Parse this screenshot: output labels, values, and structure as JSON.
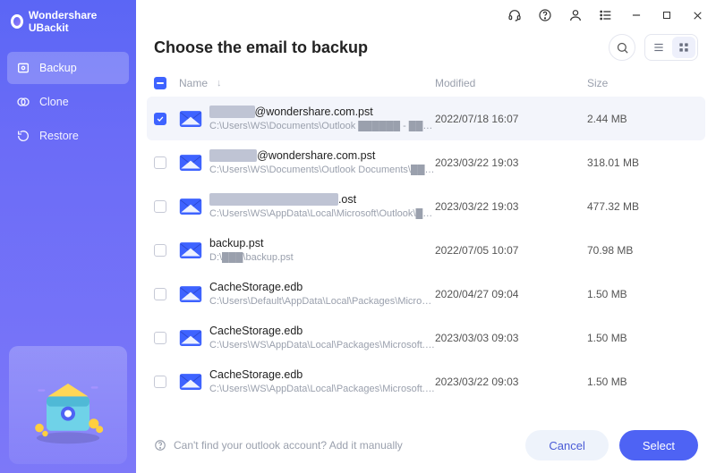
{
  "app": {
    "title": "Wondershare UBackit"
  },
  "sidebar": {
    "items": [
      {
        "label": "Backup"
      },
      {
        "label": "Clone"
      },
      {
        "label": "Restore"
      }
    ]
  },
  "header": {
    "title": "Choose the email to backup"
  },
  "columns": {
    "name": "Name",
    "modified": "Modified",
    "size": "Size"
  },
  "emails": [
    {
      "checked": true,
      "title_prefix_obf": "s█████",
      "title_suffix": "@wondershare.com.pst",
      "path": "C:\\Users\\WS\\Documents\\Outlook ██████ - ███████@wo...",
      "modified": "2022/07/18 16:07",
      "size": "2.44 MB"
    },
    {
      "checked": false,
      "title_prefix_obf": "██████",
      "title_suffix": "@wondershare.com.pst",
      "path": "C:\\Users\\WS\\Documents\\Outlook Documents\\███████ f...",
      "modified": "2023/03/22 19:03",
      "size": "318.01 MB"
    },
    {
      "checked": false,
      "title_prefix_obf": "█████████ - ██████",
      "title_suffix": ".ost",
      "path": "C:\\Users\\WS\\AppData\\Local\\Microsoft\\Outlook\\██████...",
      "modified": "2023/03/22 19:03",
      "size": "477.32 MB"
    },
    {
      "checked": false,
      "title_prefix_obf": "",
      "title_suffix": "backup.pst",
      "path": "D:\\███\\backup.pst",
      "modified": "2022/07/05 10:07",
      "size": "70.98 MB"
    },
    {
      "checked": false,
      "title_prefix_obf": "",
      "title_suffix": "CacheStorage.edb",
      "path": "C:\\Users\\Default\\AppData\\Local\\Packages\\Microsoft.W...",
      "modified": "2020/04/27 09:04",
      "size": "1.50 MB"
    },
    {
      "checked": false,
      "title_prefix_obf": "",
      "title_suffix": "CacheStorage.edb",
      "path": "C:\\Users\\WS\\AppData\\Local\\Packages\\Microsoft.Micro...",
      "modified": "2023/03/03 09:03",
      "size": "1.50 MB"
    },
    {
      "checked": false,
      "title_prefix_obf": "",
      "title_suffix": "CacheStorage.edb",
      "path": "C:\\Users\\WS\\AppData\\Local\\Packages\\Microsoft.Wind...",
      "modified": "2023/03/22 09:03",
      "size": "1.50 MB"
    }
  ],
  "footer": {
    "helper": "Can't find your outlook account? Add it manually",
    "cancel": "Cancel",
    "select": "Select"
  },
  "icons": {
    "headset": "headset-icon",
    "help": "help-icon",
    "user": "user-icon",
    "list": "list-icon",
    "min": "minimize-icon",
    "max": "maximize-icon",
    "close": "close-icon",
    "search": "search-icon",
    "listview": "list-view-icon",
    "gridview": "grid-view-icon"
  },
  "colors": {
    "accent": "#4e63f4"
  }
}
